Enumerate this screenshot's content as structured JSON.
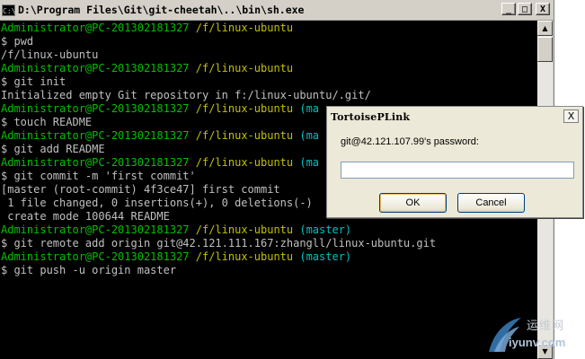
{
  "console": {
    "title": "D:\\Program Files\\Git\\git-cheetah\\..\\bin\\sh.exe",
    "app_icon_text": "C:\\",
    "buttons": {
      "minimize": "_",
      "maximize": "□",
      "close": "X"
    },
    "lines": [
      [
        {
          "t": "Administrator@PC-201302181327 ",
          "c": "user"
        },
        {
          "t": "/f/linux-ubuntu",
          "c": "path"
        }
      ],
      [
        {
          "t": "$ pwd",
          "c": "out"
        }
      ],
      [
        {
          "t": "/f/linux-ubuntu",
          "c": "out"
        }
      ],
      [
        {
          "t": "Administrator@PC-201302181327 ",
          "c": "user"
        },
        {
          "t": "/f/linux-ubuntu",
          "c": "path"
        }
      ],
      [
        {
          "t": "$ git init",
          "c": "out"
        }
      ],
      [
        {
          "t": "Initialized empty Git repository in f:/linux-ubuntu/.git/",
          "c": "out"
        }
      ],
      [
        {
          "t": "Administrator@PC-201302181327 ",
          "c": "user"
        },
        {
          "t": "/f/linux-ubuntu ",
          "c": "path"
        },
        {
          "t": "(ma",
          "c": "branch"
        }
      ],
      [
        {
          "t": "$ touch README",
          "c": "out"
        }
      ],
      [
        {
          "t": "Administrator@PC-201302181327 ",
          "c": "user"
        },
        {
          "t": "/f/linux-ubuntu ",
          "c": "path"
        },
        {
          "t": "(ma",
          "c": "branch"
        }
      ],
      [
        {
          "t": "$ git add README",
          "c": "out"
        }
      ],
      [
        {
          "t": "Administrator@PC-201302181327 ",
          "c": "user"
        },
        {
          "t": "/f/linux-ubuntu ",
          "c": "path"
        },
        {
          "t": "(ma",
          "c": "branch"
        }
      ],
      [
        {
          "t": "$ git commit -m 'first commit'",
          "c": "out"
        }
      ],
      [
        {
          "t": "[master (root-commit) 4f3ce47] first commit",
          "c": "out"
        }
      ],
      [
        {
          "t": " 1 file changed, 0 insertions(+), 0 deletions(-)",
          "c": "out"
        }
      ],
      [
        {
          "t": " create mode 100644 README",
          "c": "out"
        }
      ],
      [
        {
          "t": "Administrator@PC-201302181327 ",
          "c": "user"
        },
        {
          "t": "/f/linux-ubuntu ",
          "c": "path"
        },
        {
          "t": "(master)",
          "c": "branch"
        }
      ],
      [
        {
          "t": "$ git remote add origin git@42.121.111.167:zhangll/linux-ubuntu.git",
          "c": "out"
        }
      ],
      [
        {
          "t": "Administrator@PC-201302181327 ",
          "c": "user"
        },
        {
          "t": "/f/linux-ubuntu ",
          "c": "path"
        },
        {
          "t": "(master)",
          "c": "branch"
        }
      ],
      [
        {
          "t": "$ git push -u origin master",
          "c": "out"
        }
      ]
    ],
    "colors": {
      "user": "#00c000",
      "path": "#c0c000",
      "branch": "#00c0c0",
      "out": "#c0c0c0",
      "background": "#000000"
    }
  },
  "dialog": {
    "title": "TortoisePLink",
    "close_label": "X",
    "prompt": "git@42.121.107.99's password:",
    "password_value": "",
    "ok_label": "OK",
    "cancel_label": "Cancel"
  },
  "watermark": {
    "cn_text": "运维网",
    "url_text": "iyunv.com"
  }
}
